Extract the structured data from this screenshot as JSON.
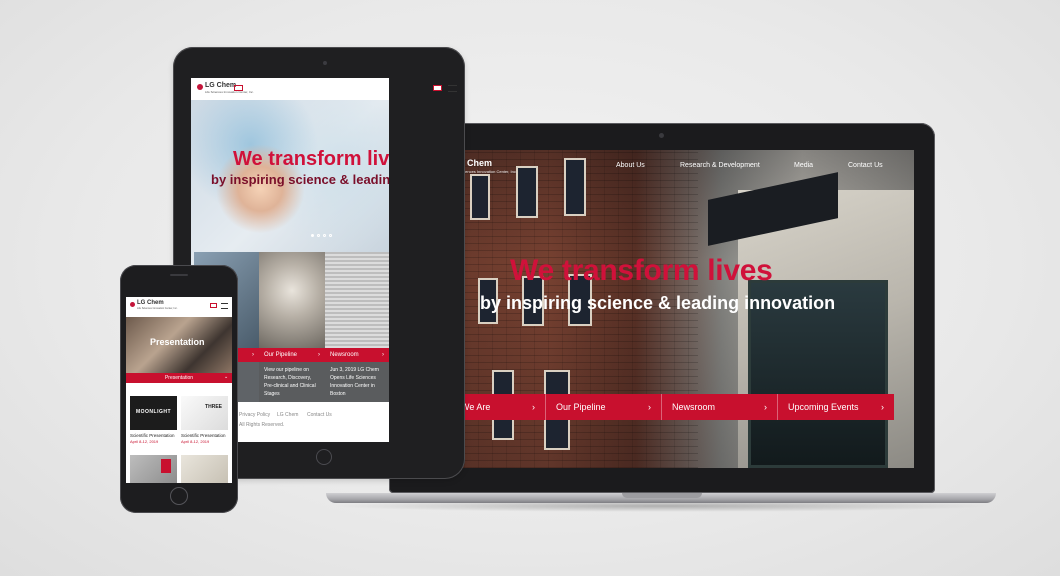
{
  "brand": {
    "name": "LG Chem",
    "subtitle": "Life Sciences Innovation Center, Inc."
  },
  "laptop": {
    "nav": [
      "About Us",
      "Research & Development",
      "Media",
      "Contact Us"
    ],
    "hero_title": "We transform lives",
    "hero_subtitle": "by inspiring science & leading innovation",
    "buttons": [
      "Who We Are",
      "Our Pipeline",
      "Newsroom",
      "Upcoming Events"
    ]
  },
  "tablet": {
    "hero_title": "We transform lives",
    "hero_subtitle": "by inspiring science & leading innovation",
    "cards": [
      {
        "label": "Our Pipeline",
        "text": "View our pipeline on Research, Discovery, Pre-clinical and Clinical Stages"
      },
      {
        "label": "Newsroom",
        "text": "Jun 3, 2019 LG Chem Opens Life Sciences Innovation Center in Boston"
      }
    ],
    "footer_links": [
      "Privacy Policy",
      "LG Chem",
      "Contact Us"
    ],
    "footer_rights": "All Rights Reserved."
  },
  "phone": {
    "hero_title": "Presentation",
    "selector": "Presentation",
    "thumbnails": [
      {
        "label": "MOONLIGHT",
        "caption": "Scientific Presentation",
        "date": "April 8-12, 2019"
      },
      {
        "label": "THREE",
        "caption": "Scientific Presentation",
        "date": "April 8-12, 2019"
      }
    ]
  },
  "colors": {
    "brand_red": "#c8102e",
    "title_red": "#d0113a"
  }
}
